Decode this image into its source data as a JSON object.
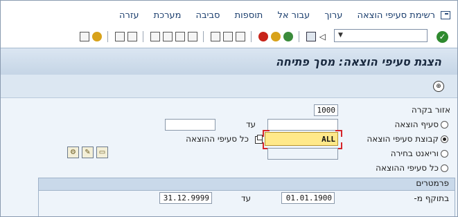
{
  "menu": {
    "items": [
      "רשימת סעיפי הוצאה",
      "ערוך",
      "עבור אל",
      "תוספות",
      "סביבה",
      "מערכת",
      "עזרה"
    ]
  },
  "toolbar": {
    "command_field_value": "",
    "enter_icon": "check-icon",
    "icons": [
      "play-icon",
      "back-icon",
      "exit-icon",
      "cancel-icon",
      "save-icon",
      "print-icon",
      "find-icon",
      "find-next-icon",
      "first-page-icon",
      "prev-page-icon",
      "next-page-icon",
      "last-page-icon",
      "create-session-icon",
      "shortcut-icon",
      "help-icon",
      "layout-icon"
    ]
  },
  "title": "הצגת סעיפי הוצאה: מסך פתיחה",
  "app_toolbar": {
    "execute_icon": "execute-icon"
  },
  "form": {
    "control_area": {
      "label": "אזור בקרה",
      "value": "1000"
    },
    "cost_element": {
      "label": "סעיף הוצאה",
      "to_label": "עד",
      "from_value": "",
      "to_value": ""
    },
    "cost_element_group": {
      "label": "קבוצת סעיפי הוצאה",
      "value": "ALL",
      "text": "כל סעיפי ההוצאה"
    },
    "variant": {
      "label": "וריאנט בחירה",
      "value": ""
    },
    "all_cost_elements": {
      "label": "כל סעיפי ההוצאה"
    },
    "selected_option": "cost_element_group"
  },
  "parameters": {
    "header": "פרמטרים",
    "valid_from": {
      "label": "בתוקף מ-",
      "value": "01.01.1900"
    },
    "to": {
      "label": "עד",
      "value": "31.12.9999"
    }
  }
}
